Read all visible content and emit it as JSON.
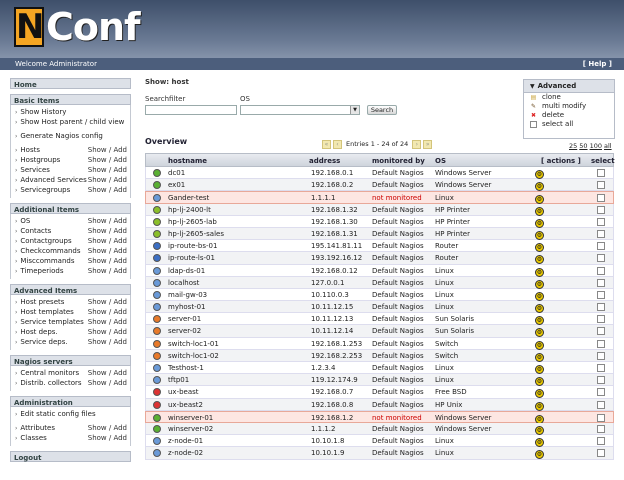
{
  "brand": {
    "n": "N",
    "rest": "Conf"
  },
  "welcome": {
    "text": "Welcome Administrator",
    "help": "[ Help ]"
  },
  "sidebar": [
    {
      "title": "Home",
      "items": []
    },
    {
      "title": "Basic Items",
      "items": [
        {
          "label": "Show History",
          "actions": ""
        },
        {
          "label": "Show Host parent / child view",
          "actions": ""
        },
        {
          "gap": true
        },
        {
          "label": "Generate Nagios config",
          "actions": ""
        },
        {
          "gap": true
        },
        {
          "label": "Hosts",
          "actions": "Show / Add"
        },
        {
          "label": "Hostgroups",
          "actions": "Show / Add"
        },
        {
          "label": "Services",
          "actions": "Show / Add"
        },
        {
          "label": "Advanced Services",
          "actions": "Show / Add"
        },
        {
          "label": "Servicegroups",
          "actions": "Show / Add"
        }
      ]
    },
    {
      "title": "Additional Items",
      "items": [
        {
          "label": "OS",
          "actions": "Show / Add"
        },
        {
          "label": "Contacts",
          "actions": "Show / Add"
        },
        {
          "label": "Contactgroups",
          "actions": "Show / Add"
        },
        {
          "label": "Checkcommands",
          "actions": "Show / Add"
        },
        {
          "label": "Misccommands",
          "actions": "Show / Add"
        },
        {
          "label": "Timeperiods",
          "actions": "Show / Add"
        }
      ]
    },
    {
      "title": "Advanced Items",
      "items": [
        {
          "label": "Host presets",
          "actions": "Show / Add"
        },
        {
          "label": "Host templates",
          "actions": "Show / Add"
        },
        {
          "label": "Service templates",
          "actions": "Show / Add"
        },
        {
          "label": "Host deps.",
          "actions": "Show / Add"
        },
        {
          "label": "Service deps.",
          "actions": "Show / Add"
        }
      ]
    },
    {
      "title": "Nagios servers",
      "items": [
        {
          "label": "Central monitors",
          "actions": "Show / Add"
        },
        {
          "label": "Distrib. collectors",
          "actions": "Show / Add"
        }
      ]
    },
    {
      "title": "Administration",
      "items": [
        {
          "label": "Edit static config files",
          "actions": ""
        },
        {
          "gap": true
        },
        {
          "label": "Attributes",
          "actions": "Show / Add"
        },
        {
          "label": "Classes",
          "actions": "Show / Add"
        }
      ]
    },
    {
      "title": "Logout",
      "items": []
    }
  ],
  "main": {
    "title": "Show: host",
    "search_filter_label": "Searchfilter",
    "os_label": "OS",
    "search_value": "",
    "os_value": "",
    "search_button": "Search"
  },
  "advanced": {
    "title": "Advanced",
    "items": [
      {
        "label": "clone",
        "icon": "clone-icon",
        "glyph": "▤",
        "color": "#c9a33a"
      },
      {
        "label": "multi modify",
        "icon": "multi-modify-icon",
        "glyph": "✎",
        "color": "#6b4a1e"
      },
      {
        "label": "delete",
        "icon": "delete-icon",
        "glyph": "✖",
        "color": "#d22"
      },
      {
        "label": "select all",
        "icon": "select-all-icon",
        "glyph": "",
        "color": "#fff"
      }
    ]
  },
  "overview": {
    "title": "Overview",
    "entries": "Entries 1 - 24 of 24",
    "per_page": [
      "25",
      "50",
      "100",
      "all"
    ]
  },
  "table": {
    "headers": {
      "hostname": "hostname",
      "address": "address",
      "monitored_by": "monitored by",
      "os": "OS",
      "actions": "[ actions ]",
      "select": "select"
    },
    "rows": [
      {
        "host": "dc01",
        "addr": "192.168.0.1",
        "mon": "Default Nagios",
        "os": "Windows Server",
        "color": "#5ab033",
        "err": false
      },
      {
        "host": "ex01",
        "addr": "192.168.0.2",
        "mon": "Default Nagios",
        "os": "Windows Server",
        "color": "#5ab033",
        "err": false
      },
      {
        "host": "Gander-test",
        "addr": "1.1.1.1",
        "mon": "not monitored",
        "os": "Linux",
        "color": "#6a9ad8",
        "err": true
      },
      {
        "host": "hp-lj-2400-lt",
        "addr": "192.168.1.32",
        "mon": "Default Nagios",
        "os": "HP Printer",
        "color": "#8bbf2a",
        "err": false
      },
      {
        "host": "hp-lj-2605-lab",
        "addr": "192.168.1.30",
        "mon": "Default Nagios",
        "os": "HP Printer",
        "color": "#8bbf2a",
        "err": false
      },
      {
        "host": "hp-lj-2605-sales",
        "addr": "192.168.1.31",
        "mon": "Default Nagios",
        "os": "HP Printer",
        "color": "#8bbf2a",
        "err": false
      },
      {
        "host": "ip-route-bs-01",
        "addr": "195.141.81.11",
        "mon": "Default Nagios",
        "os": "Router",
        "color": "#3c6fc4",
        "err": false
      },
      {
        "host": "ip-route-ls-01",
        "addr": "193.192.16.12",
        "mon": "Default Nagios",
        "os": "Router",
        "color": "#3c6fc4",
        "err": false
      },
      {
        "host": "ldap-ds-01",
        "addr": "192.168.0.12",
        "mon": "Default Nagios",
        "os": "Linux",
        "color": "#6a9ad8",
        "err": false
      },
      {
        "host": "localhost",
        "addr": "127.0.0.1",
        "mon": "Default Nagios",
        "os": "Linux",
        "color": "#6a9ad8",
        "err": false
      },
      {
        "host": "mail-gw-03",
        "addr": "10.110.0.3",
        "mon": "Default Nagios",
        "os": "Linux",
        "color": "#6a9ad8",
        "err": false
      },
      {
        "host": "myhost-01",
        "addr": "10.11.12.15",
        "mon": "Default Nagios",
        "os": "Linux",
        "color": "#6a9ad8",
        "err": false
      },
      {
        "host": "server-01",
        "addr": "10.11.12.13",
        "mon": "Default Nagios",
        "os": "Sun Solaris",
        "color": "#e87a2a",
        "err": false
      },
      {
        "host": "server-02",
        "addr": "10.11.12.14",
        "mon": "Default Nagios",
        "os": "Sun Solaris",
        "color": "#e87a2a",
        "err": false
      },
      {
        "host": "switch-loc1-01",
        "addr": "192.168.1.253",
        "mon": "Default Nagios",
        "os": "Switch",
        "color": "#e87a2a",
        "err": false
      },
      {
        "host": "switch-loc1-02",
        "addr": "192.168.2.253",
        "mon": "Default Nagios",
        "os": "Switch",
        "color": "#e87a2a",
        "err": false
      },
      {
        "host": "Testhost-1",
        "addr": "1.2.3.4",
        "mon": "Default Nagios",
        "os": "Linux",
        "color": "#6a9ad8",
        "err": false
      },
      {
        "host": "tftp01",
        "addr": "119.12.174.9",
        "mon": "Default Nagios",
        "os": "Linux",
        "color": "#6a9ad8",
        "err": false
      },
      {
        "host": "ux-beast",
        "addr": "192.168.0.7",
        "mon": "Default Nagios",
        "os": "Free BSD",
        "color": "#d33",
        "err": false
      },
      {
        "host": "ux-beast2",
        "addr": "192.168.0.8",
        "mon": "Default Nagios",
        "os": "HP Unix",
        "color": "#d33",
        "err": false
      },
      {
        "host": "winserver-01",
        "addr": "192.168.1.2",
        "mon": "not monitored",
        "os": "Windows Server",
        "color": "#5ab033",
        "err": true
      },
      {
        "host": "winserver-02",
        "addr": "1.1.1.2",
        "mon": "Default Nagios",
        "os": "Windows Server",
        "color": "#5ab033",
        "err": false
      },
      {
        "host": "z-node-01",
        "addr": "10.10.1.8",
        "mon": "Default Nagios",
        "os": "Linux",
        "color": "#6a9ad8",
        "err": false
      },
      {
        "host": "z-node-02",
        "addr": "10.10.1.9",
        "mon": "Default Nagios",
        "os": "Linux",
        "color": "#6a9ad8",
        "err": false
      }
    ]
  }
}
